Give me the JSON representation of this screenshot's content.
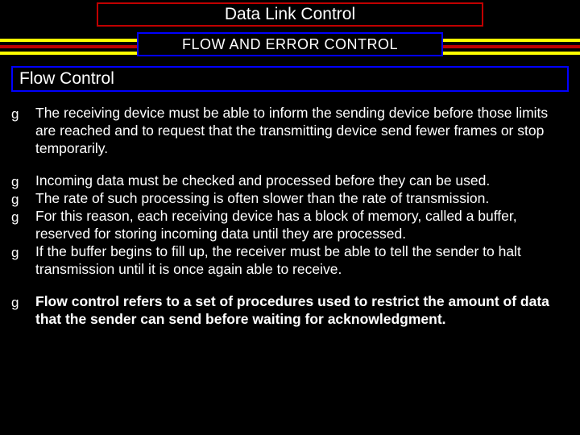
{
  "title": "Data Link Control",
  "subtitle": "FLOW AND ERROR CONTROL",
  "section_heading": "Flow Control",
  "bullets": {
    "group1": [
      "The receiving device must be able to inform the sending device before those limits are reached and to request that the transmitting device send fewer frames or stop temporarily."
    ],
    "group2": [
      "Incoming data must be checked and processed before they can be used.",
      "The rate of such processing is often slower than the rate of transmission.",
      "For this reason, each receiving device has a block of memory, called a buffer, reserved for storing incoming data until they are processed.",
      "If the buffer begins to fill up, the receiver must be able to tell the sender to halt transmission until it is once again able to receive."
    ],
    "group3": [
      "Flow control refers to a set of procedures used to restrict the amount of data that the sender can send before waiting for acknowledgment."
    ]
  },
  "bullet_marker": "g"
}
